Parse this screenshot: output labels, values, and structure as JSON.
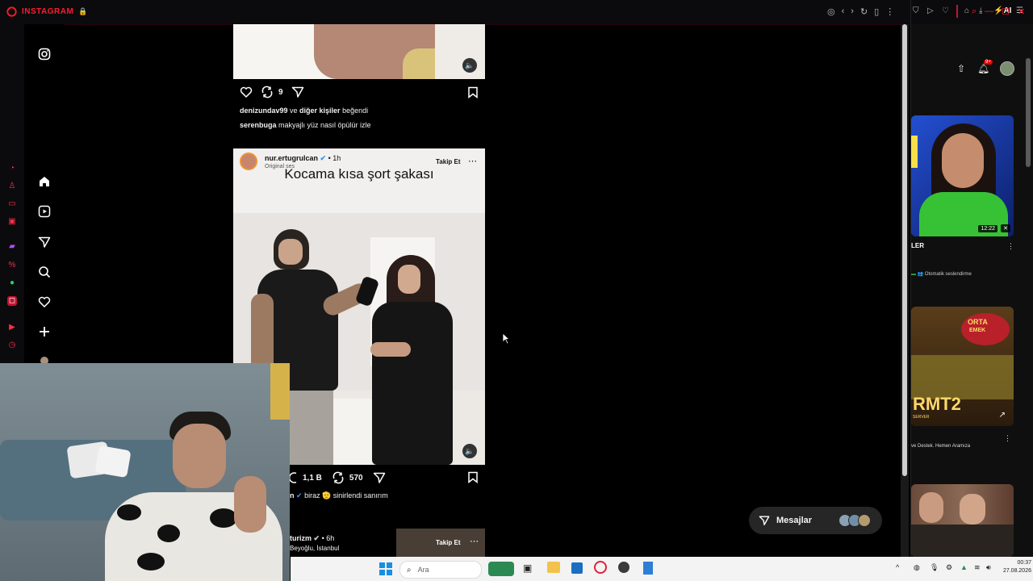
{
  "titlebar": {
    "app_name": "INSTAGRAM"
  },
  "right_toolbar": {
    "ai_label": "AI",
    "badge_count": "9+"
  },
  "post1": {
    "comment_count": "9",
    "liked_by_user": "denizundav99",
    "liked_by_conj": " ve ",
    "liked_by_others": "diğer kişiler",
    "liked_by_suffix": " beğendi",
    "caption_user": "serenbuga",
    "caption_text": " makyajlı yüz nasıl öpülür izle"
  },
  "post2": {
    "username": "nur.ertugrulcan",
    "time": "• 1h",
    "audio": "Original ses",
    "follow_label": "Takip Et",
    "overlay_text": "Kocama kısa şort şakası",
    "comment_count": "1,1 B",
    "share_count": "570",
    "caption_user_partial": "n",
    "caption_text": " biraz 🫡 sinirlendi sanırım"
  },
  "post3": {
    "username_partial": "turizm",
    "time": "• 6h",
    "location": "Beyoğlu, İstanbul",
    "follow_label": "Takip Et"
  },
  "messages": {
    "label": "Mesajlar"
  },
  "right_panel": {
    "video1_duration": "12:22",
    "video1_title_partial": "LER",
    "video1_caption_tag": "Otomatik seslendirme",
    "video2_logo_top": "ORTA",
    "video2_logo_bottom": "EMEK",
    "video2_title": "RMT2",
    "video2_subtitle": "SERVER",
    "video2_caption": "ve Destek. Hemen Aramıza"
  },
  "taskbar": {
    "search_placeholder": "Ara",
    "time": "00:37",
    "date": "27.08.2026"
  },
  "colors": {
    "opera_red": "#ff1b2d",
    "ig_bg": "#000000",
    "pill_bg": "#262626"
  }
}
